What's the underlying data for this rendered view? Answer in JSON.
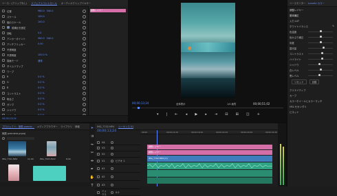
{
  "colors": {
    "accent": "#5d8bff",
    "clip_pink": "#d46fa8",
    "clip_blue": "#3f7dbd",
    "audio_green": "#2fa383",
    "background": "#1c1c1c"
  },
  "effect_controls": {
    "tabs": [
      "ソース：(クリップなし)",
      "エフェクトコントロール",
      "オーディオクリップミキサー"
    ],
    "clip_label": "調整レイヤー",
    "rows": [
      {
        "label": "位置",
        "value": "960.0",
        "value2": "540.0"
      },
      {
        "label": "スケール",
        "value": "100.0"
      },
      {
        "label": "幅のスケール",
        "value": "100.0"
      },
      {
        "label": "縦横比を固定",
        "checked": true
      },
      {
        "label": "回転",
        "value": "0.0"
      },
      {
        "label": "アンカーポイント",
        "value": "960.0",
        "value2": "540.0"
      },
      {
        "label": "アンチフリッカー",
        "value": "0.00"
      },
      {
        "label": "不透明度",
        "value": ""
      },
      {
        "label": "不透明度",
        "value": "100.0 %"
      },
      {
        "label": "描画モード",
        "value": "通常"
      },
      {
        "label": "タイムリマップ",
        "value": ""
      },
      {
        "label": "ワープ",
        "value": ""
      },
      {
        "label": "R",
        "value": "0.0 %"
      },
      {
        "label": "G",
        "value": "0.0 %"
      },
      {
        "label": "B",
        "value": "0.0 %"
      },
      {
        "label": "コントラスト",
        "value": "0.0 %"
      },
      {
        "label": "明るさ",
        "value": "0.0 %"
      },
      {
        "label": "ガンマ",
        "value": "0.0 %"
      },
      {
        "label": "シャドウ",
        "value": "0.0 %"
      },
      {
        "label": "リミッター",
        "value": "0.0 %"
      }
    ],
    "timecode": "00;00;13;24"
  },
  "program": {
    "timecode": "00;00;13;24",
    "fit": "全体表示",
    "quality": "1/4 画質",
    "duration": "00;00;51;02"
  },
  "lumetri": {
    "tabs": [
      "ソースモニター",
      "Lumetri カラー",
      "Lumetri スコープ"
    ],
    "clip": "調整レイヤー",
    "sections": [
      "基本補正",
      "入力 LUT",
      "ホワイトバランス",
      "トーン",
      "カラー"
    ],
    "sliders": [
      {
        "label": "色温度",
        "level": 0.5
      },
      {
        "label": "色かぶり補正",
        "level": 0.5
      },
      {
        "label": "彩度",
        "level": 0.5
      },
      {
        "label": "露光量",
        "level": 0.62
      },
      {
        "label": "コントラスト",
        "level": 0.55
      },
      {
        "label": "ハイライト",
        "level": 0.55
      },
      {
        "label": "シャドウ",
        "level": 0.45
      },
      {
        "label": "白レベル",
        "level": 0.5
      },
      {
        "label": "黒レベル",
        "level": 0.45
      }
    ],
    "reset": "リセット",
    "auto": "自動",
    "lower": [
      "クリエイティブ",
      "カーブ",
      "カラーホイールとカラーマッチ",
      "HSL セカンダリ",
      "ビネット"
    ]
  },
  "project": {
    "tabs": [
      "プロジェクト：無題 premie...",
      "メディアブラウザー",
      "ライブラリ",
      "情報"
    ],
    "file": "無題 premiere.prproj",
    "items": [
      {
        "name": "IMG_7701.MP4",
        "duration": "11;00"
      },
      {
        "name": "IMG_7503.MOV",
        "duration": "8;00"
      },
      {
        "name": "IMG_8001.MP4",
        "duration": "6;00"
      },
      {
        "name": "IMG_7712.MOV",
        "duration": "9;00"
      }
    ]
  },
  "timeline": {
    "tabs": [
      "IMG_7702.MP4",
      "シーケンス 01"
    ],
    "timecode": "00;00;13;24",
    "ruler": [
      "00;00",
      "00;00;14;29",
      "00;00;19;29",
      "00;00;24;29",
      "00;00;29;29",
      "00;00;34;29"
    ],
    "tracks": [
      {
        "name": "V4",
        "label": "",
        "kind": "video"
      },
      {
        "name": "V3",
        "label": "",
        "kind": "video"
      },
      {
        "name": "V2",
        "label": "",
        "kind": "video"
      },
      {
        "name": "V1",
        "label": "ビデオ 1",
        "kind": "video"
      },
      {
        "name": "A1",
        "label": "",
        "kind": "audio"
      },
      {
        "name": "A2",
        "label": "",
        "kind": "audio"
      },
      {
        "name": "A3",
        "label": "",
        "kind": "audio"
      },
      {
        "name": "ミックス",
        "label": "0.0",
        "kind": "master"
      }
    ],
    "clips": [
      {
        "label": "調整レイヤー",
        "kind": "pink"
      },
      {
        "label": "調整レイヤー",
        "kind": "pink"
      },
      {
        "label": "IMG_7702.MP4 [V]",
        "kind": "blue"
      }
    ]
  }
}
